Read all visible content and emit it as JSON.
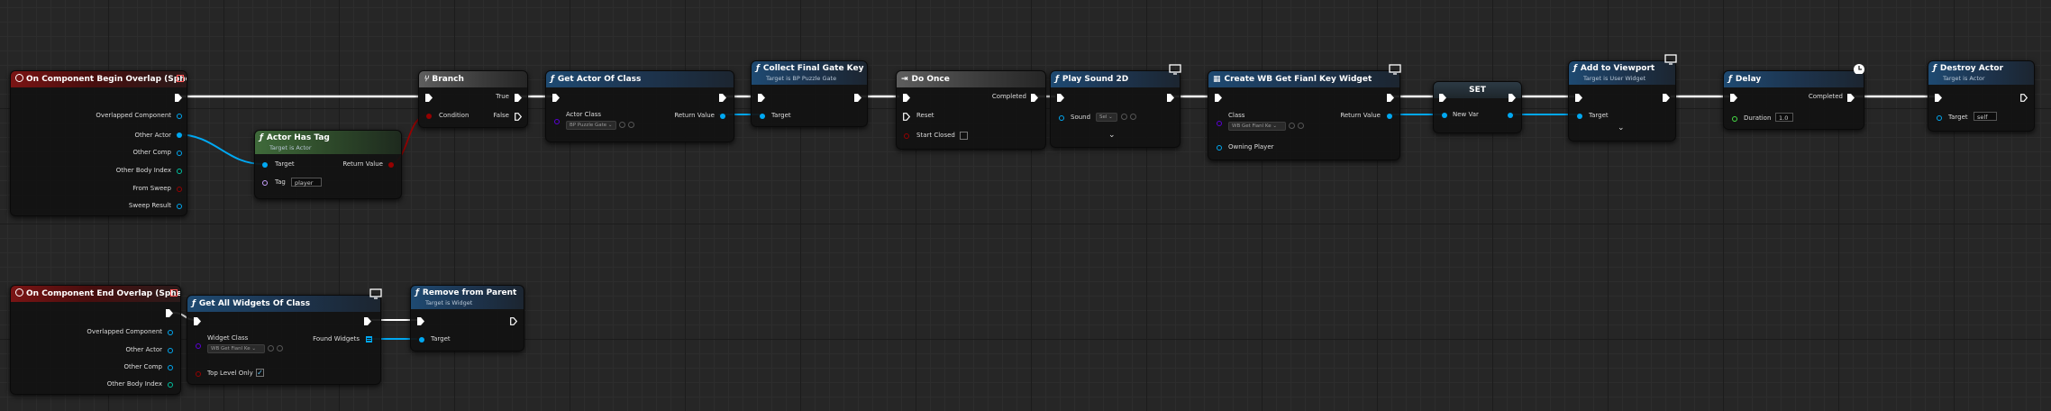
{
  "events": {
    "begin": {
      "title": "On Component Begin Overlap (Sphere)",
      "pins": [
        "Overlapped Component",
        "Other Actor",
        "Other Comp",
        "Other Body Index",
        "From Sweep",
        "Sweep Result"
      ]
    },
    "end": {
      "title": "On Component End Overlap (Sphere)",
      "pins": [
        "Overlapped Component",
        "Other Actor",
        "Other Comp",
        "Other Body Index"
      ]
    }
  },
  "actor_has_tag": {
    "title": "Actor Has Tag",
    "subtitle": "Target is Actor",
    "target": "Target",
    "return": "Return Value",
    "tag_label": "Tag",
    "tag_value": "player"
  },
  "branch": {
    "title": "Branch",
    "condition": "Condition",
    "true": "True",
    "false": "False"
  },
  "get_actor_of_class": {
    "title": "Get Actor Of Class",
    "actor_class": "Actor Class",
    "class_value": "BP Puzzle Gate",
    "return": "Return Value"
  },
  "collect_final_gate_key": {
    "title": "Collect Final Gate Key",
    "subtitle": "Target is BP Puzzle Gate",
    "target": "Target"
  },
  "do_once": {
    "title": "Do Once",
    "completed": "Completed",
    "reset": "Reset",
    "start_closed": "Start Closed"
  },
  "play_sound": {
    "title": "Play Sound 2D",
    "sound": "Sound",
    "sound_value": "Sel"
  },
  "create_widget": {
    "title": "Create WB Get Fianl Key Widget",
    "class": "Class",
    "class_value": "WB Get Fianl Ke",
    "return": "Return Value",
    "owning_player": "Owning Player"
  },
  "set_node": {
    "title": "SET",
    "new_var": "New Var"
  },
  "add_to_viewport": {
    "title": "Add to Viewport",
    "subtitle": "Target is User Widget",
    "target": "Target"
  },
  "delay": {
    "title": "Delay",
    "completed": "Completed",
    "duration": "Duration",
    "duration_value": "1.0"
  },
  "destroy_actor": {
    "title": "Destroy Actor",
    "subtitle": "Target is Actor",
    "target": "Target",
    "target_value": "self"
  },
  "get_all_widgets": {
    "title": "Get All Widgets Of Class",
    "widget_class": "Widget Class",
    "class_value": "WB Get Fianl Ke",
    "found": "Found Widgets",
    "top_level": "Top Level Only"
  },
  "remove_from_parent": {
    "title": "Remove from Parent",
    "subtitle": "Target is Widget",
    "target": "Target"
  },
  "colors": {
    "exec": "#ffffff",
    "object": "#00a8f2",
    "bool": "#950000",
    "event_header": "#7a1414",
    "function_header": "#1e4a72",
    "pure_header": "#3f6a3a"
  }
}
